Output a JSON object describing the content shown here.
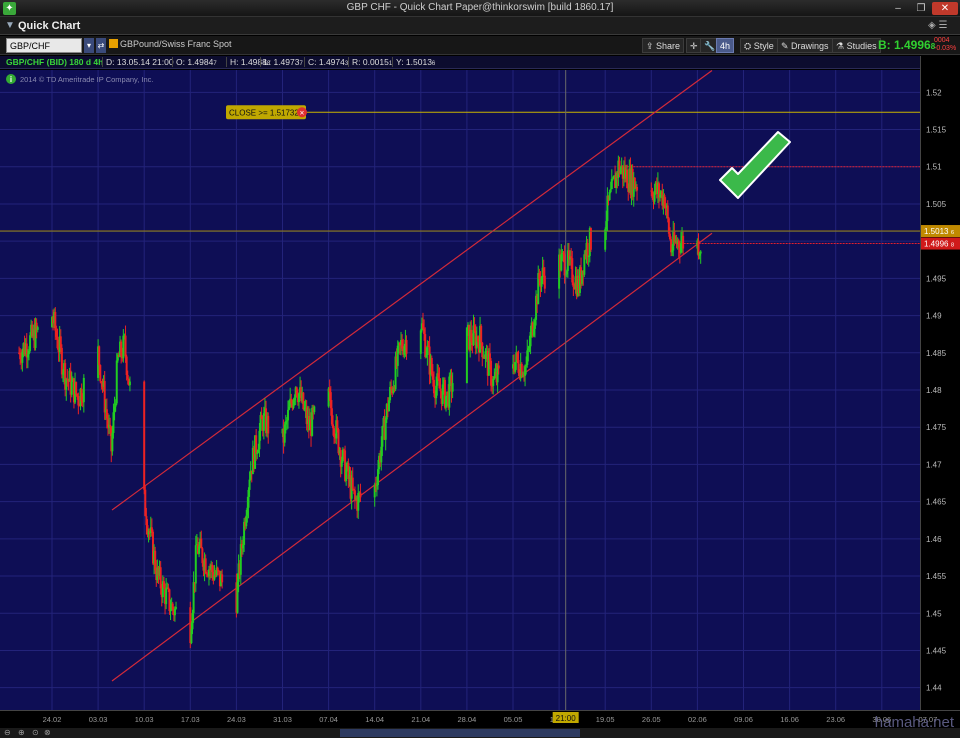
{
  "window": {
    "title": "GBP CHF - Quick Chart Paper@thinkorswim [build 1860.17]",
    "app_icon": "thinkorswim-logo-icon",
    "minimize": "–",
    "maximize": "❐",
    "close": "✕"
  },
  "panel": {
    "label": "Quick Chart"
  },
  "toolbar": {
    "symbol": "GBP/CHF",
    "description": "GBPound/Swiss Franc Spot",
    "share_label": "Share",
    "timeframe": "4h",
    "style_label": "Style",
    "drawings_label": "Drawings",
    "studies_label": "Studies",
    "bid": "B: 1.4996",
    "bid_small": "8",
    "change_top": "0004",
    "change_bottom": "-0.03%"
  },
  "info": {
    "symbol": "GBP/CHF (BID) 180 d 4h",
    "d": "D: 13.05.14 21:00",
    "o": "O: 1.4984",
    "o_small": "7",
    "h": "H: 1.4988",
    "h_small": "8",
    "l": "L: 1.4973",
    "l_small": "7",
    "c": "C: 1.4974",
    "c_small": "3",
    "r": "R: 0.0015",
    "r_small": "1",
    "y": "Y: 1.5013",
    "y_small": "6"
  },
  "copyright": "2014 © TD Ameritrade IP Company, Inc.",
  "alert_label": "CLOSE >= 1.51732",
  "crosshair_time": "21:00",
  "watermark": "hamaha.net",
  "colors": {
    "background": "#0e0e55",
    "up_candle": "#22cc22",
    "down_candle": "#ee2222",
    "channel": "#d22a3a",
    "alert_line": "#c8b400",
    "checkmark": "#3bb94a"
  },
  "chart_data": {
    "type": "candlestick",
    "instrument": "GBP/CHF",
    "ylim": [
      1.437,
      1.523
    ],
    "y_ticks": [
      "1.52",
      "1.515",
      "1.51",
      "1.505",
      "1.5",
      "1.495",
      "1.49",
      "1.485",
      "1.48",
      "1.475",
      "1.47",
      "1.465",
      "1.46",
      "1.455",
      "1.45",
      "1.445",
      "1.44"
    ],
    "x_ticks": [
      "24.02",
      "03.03",
      "10.03",
      "17.03",
      "24.03",
      "31.03",
      "07.04",
      "14.04",
      "21.04",
      "28.04",
      "05.05",
      "12.05",
      "19.05",
      "26.05",
      "02.06",
      "09.06",
      "16.06",
      "23.06",
      "30.06",
      "07.07"
    ],
    "price_tags": [
      {
        "value": 1.50136,
        "label": "1.5013",
        "small": "6",
        "kind": "prev-close"
      },
      {
        "value": 1.49968,
        "label": "1.4996",
        "small": "8",
        "kind": "last-bid"
      }
    ],
    "resistance_level": 1.51,
    "alert_level": 1.51732,
    "channel": {
      "upper": {
        "start": [
          "03.03",
          1.4625
        ],
        "end": [
          "02.06",
          1.5215
        ]
      },
      "lower": {
        "start": [
          "03.03",
          1.4395
        ],
        "end": [
          "02.06",
          1.4996
        ]
      }
    },
    "close_path": [
      [
        "24.02",
        1.49
      ],
      [
        "26.02",
        1.482
      ],
      [
        "28.02",
        1.479
      ],
      [
        "03.03",
        1.485
      ],
      [
        "05.03",
        1.472
      ],
      [
        "06.03",
        1.484
      ],
      [
        "07.03",
        1.486
      ],
      [
        "10.03",
        1.465
      ],
      [
        "12.03",
        1.455
      ],
      [
        "14.03",
        1.451
      ],
      [
        "17.03",
        1.448
      ],
      [
        "18.03",
        1.459
      ],
      [
        "20.03",
        1.456
      ],
      [
        "24.03",
        1.452
      ],
      [
        "26.03",
        1.469
      ],
      [
        "28.03",
        1.476
      ],
      [
        "31.03",
        1.473
      ],
      [
        "02.04",
        1.481
      ],
      [
        "04.04",
        1.475
      ],
      [
        "07.04",
        1.479
      ],
      [
        "09.04",
        1.471
      ],
      [
        "11.04",
        1.465
      ],
      [
        "14.04",
        1.467
      ],
      [
        "16.04",
        1.478
      ],
      [
        "18.04",
        1.486
      ],
      [
        "21.04",
        1.489
      ],
      [
        "23.04",
        1.481
      ],
      [
        "25.04",
        1.479
      ],
      [
        "28.04",
        1.487
      ],
      [
        "30.04",
        1.487
      ],
      [
        "02.05",
        1.481
      ],
      [
        "05.05",
        1.484
      ],
      [
        "07.05",
        1.483
      ],
      [
        "09.05",
        1.495
      ],
      [
        "12.05",
        1.497
      ],
      [
        "13.05",
        1.4974
      ],
      [
        "15.05",
        1.494
      ],
      [
        "16.05",
        1.499
      ],
      [
        "19.05",
        1.503
      ],
      [
        "21.05",
        1.51
      ],
      [
        "23.05",
        1.508
      ],
      [
        "26.05",
        1.507
      ],
      [
        "28.05",
        1.506
      ],
      [
        "29.05",
        1.499
      ],
      [
        "30.05",
        1.5
      ],
      [
        "02.06",
        1.4997
      ]
    ]
  }
}
